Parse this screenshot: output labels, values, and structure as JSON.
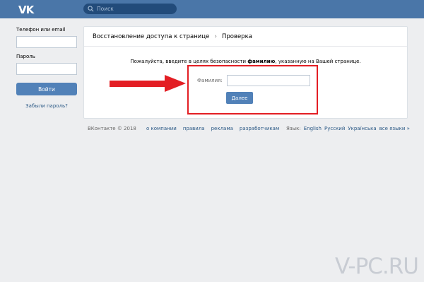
{
  "header": {
    "logo": "VK",
    "search_placeholder": "Поиск"
  },
  "login": {
    "phone_label": "Телефон или email",
    "password_label": "Пароль",
    "login_button": "Войти",
    "forgot_link": "Забыли пароль?"
  },
  "card": {
    "breadcrumb": [
      "Восстановление доступа к странице",
      "Проверка"
    ],
    "prompt_before": "Пожалуйста, введите в целях безопасности ",
    "prompt_bold": "фамилию",
    "prompt_after": ", указанную на Вашей странице.",
    "surname_label": "Фамилия:",
    "surname_value": "",
    "next_button": "Далее"
  },
  "footer": {
    "copyright": "ВКонтакте © 2018",
    "links": [
      "о компании",
      "правила",
      "реклама",
      "разработчикам"
    ],
    "language_label": "Язык:",
    "languages": [
      "English",
      "Русский",
      "Українська",
      "все языки »"
    ]
  },
  "annotation": {
    "color": "#e31e24"
  },
  "watermark": "V-PC.RU"
}
